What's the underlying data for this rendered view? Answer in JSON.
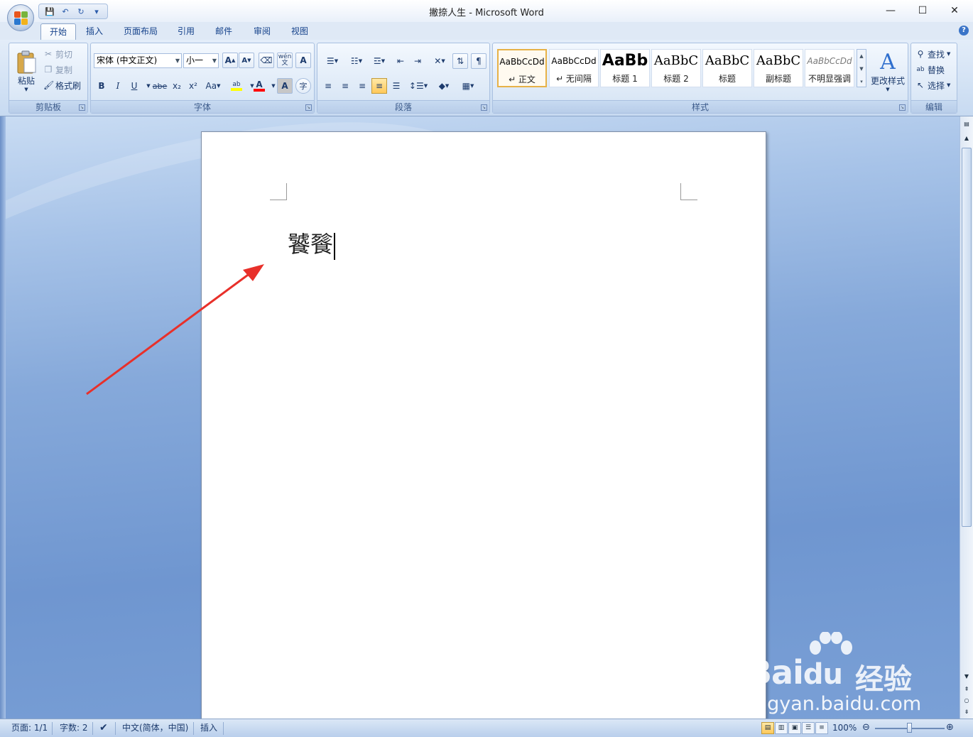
{
  "window": {
    "title": "撇捺人生 - Microsoft Word",
    "controls": {
      "minimize": "—",
      "maximize": "☐",
      "close": "✕"
    }
  },
  "quick_access": {
    "save": "💾",
    "undo": "↶",
    "redo": "↻",
    "customize": "▾"
  },
  "tabs": [
    "开始",
    "插入",
    "页面布局",
    "引用",
    "邮件",
    "审阅",
    "视图"
  ],
  "active_tab": "开始",
  "ribbon": {
    "clipboard": {
      "label": "剪贴板",
      "paste": "粘贴",
      "cut": "剪切",
      "copy": "复制",
      "format_painter": "格式刷"
    },
    "font": {
      "label": "字体",
      "font_name": "宋体 (中文正文)",
      "font_size": "小一",
      "grow": "A",
      "shrink": "A",
      "bold": "B",
      "italic": "I",
      "underline": "U",
      "strike": "abe",
      "subscript": "x₂",
      "superscript": "x²",
      "change_case": "Aa",
      "highlight": "ab",
      "font_color": "A",
      "char_shading": "A",
      "enclose": "字",
      "phonetic": "wén",
      "char_border": "A"
    },
    "paragraph": {
      "label": "段落"
    },
    "styles": {
      "label": "样式",
      "items": [
        {
          "sample": "AaBbCcDd",
          "name": "↵ 正文"
        },
        {
          "sample": "AaBbCcDd",
          "name": "↵ 无间隔"
        },
        {
          "sample": "AaBb",
          "name": "标题 1"
        },
        {
          "sample": "AaBbC",
          "name": "标题 2"
        },
        {
          "sample": "AaBbC",
          "name": "标题"
        },
        {
          "sample": "AaBbC",
          "name": "副标题"
        },
        {
          "sample": "AaBbCcDd",
          "name": "不明显强调"
        }
      ],
      "change_styles": "更改样式"
    },
    "editing": {
      "label": "编辑",
      "find": "查找",
      "replace": "替换",
      "select": "选择"
    }
  },
  "document": {
    "text": "饕餮"
  },
  "status": {
    "page": "页面: 1/1",
    "words": "字数: 2",
    "language": "中文(简体，中国)",
    "mode": "插入",
    "zoom": "100%"
  },
  "watermark": {
    "brand": "Bai",
    "jy": "经验",
    "url": "jingyan.baidu.com"
  },
  "colors": {
    "accent": "#ff0000",
    "highlight": "#ffff00",
    "annotation_arrow": "#e8302a"
  }
}
